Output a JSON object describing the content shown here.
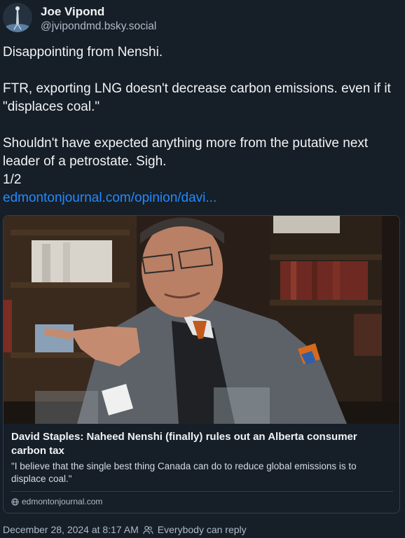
{
  "author": {
    "display_name": "Joe Vipond",
    "handle": "@jvipondmd.bsky.social"
  },
  "post": {
    "text": "Disappointing from Nenshi.\n\nFTR, exporting LNG doesn't decrease carbon emissions. even if it \"displaces coal.\"\n\nShouldn't have expected anything more from the putative next leader of a petrostate. Sigh.\n1/2",
    "link_text": "edmontonjournal.com/opinion/davi..."
  },
  "embed": {
    "title": "David Staples: Naheed Nenshi (finally) rules out an Alberta consumer carbon tax",
    "description": "\"I believe that the single best thing Canada can do to reduce global emissions is to displace coal.\"",
    "domain": "edmontonjournal.com",
    "domain_icon": "globe-icon"
  },
  "meta": {
    "timestamp": "December 28, 2024 at 8:17 AM",
    "reply_setting": "Everybody can reply",
    "reply_icon": "people-icon"
  },
  "colors": {
    "background": "#161e27",
    "link": "#208bfe",
    "muted_text": "#aebbc9",
    "border": "#2e4052"
  }
}
